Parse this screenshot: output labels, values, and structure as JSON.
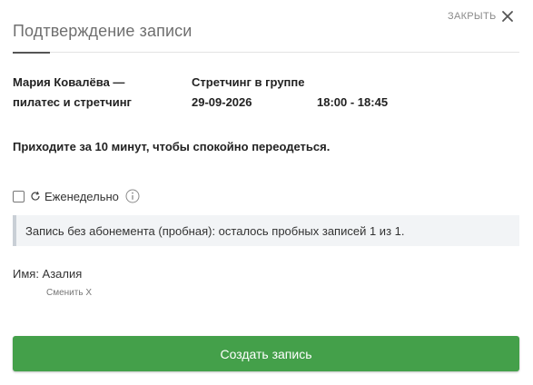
{
  "dialog": {
    "title": "Подтверждение записи",
    "close_label": "ЗАКРЫТЬ",
    "close_icon": "close-icon"
  },
  "booking": {
    "trainer_line1": "Мария Ковалёва —",
    "trainer_line2": "пилатес и стретчинг",
    "class_name": "Стретчинг в группе",
    "date": "29-09-2026",
    "time": "18:00 - 18:45"
  },
  "notice": "Приходите за 10 минут, чтобы спокойно переодеться.",
  "weekly": {
    "label": "Еженедельно",
    "checked": false,
    "repeat_icon": "repeat-icon",
    "info_icon": "info-icon"
  },
  "alert": {
    "text": "Запись без абонемента (пробная): осталось пробных записей 1 из 1."
  },
  "client": {
    "name_label": "Имя: Азалия",
    "change_label": "Сменить X"
  },
  "submit_label": "Создать запись",
  "colors": {
    "primary": "#44a04a",
    "alert_bg": "#f2f4f6",
    "alert_border": "#c9cfd6"
  }
}
